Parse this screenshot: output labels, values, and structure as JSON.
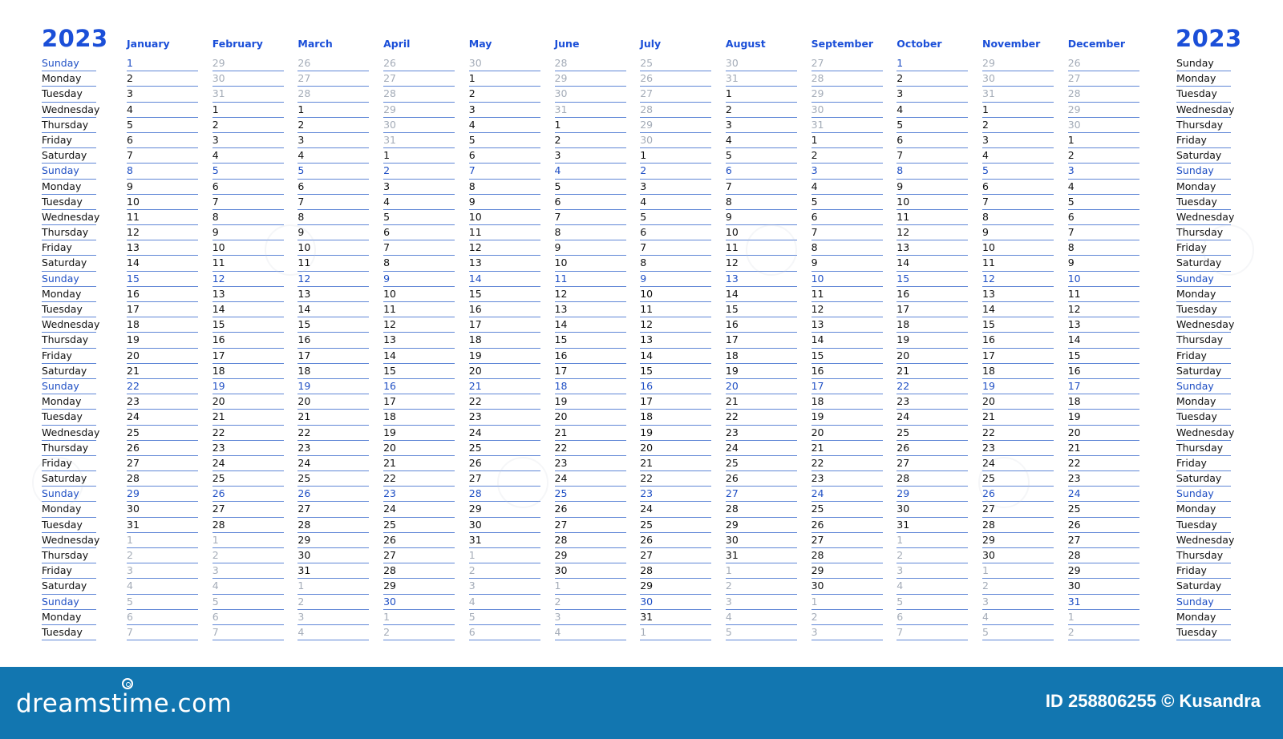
{
  "year_label": "2023",
  "weekday_rows": [
    "Sunday",
    "Monday",
    "Tuesday",
    "Wednesday",
    "Thursday",
    "Friday",
    "Saturday",
    "Sunday",
    "Monday",
    "Tuesday",
    "Wednesday",
    "Thursday",
    "Friday",
    "Saturday",
    "Sunday",
    "Monday",
    "Tuesday",
    "Wednesday",
    "Thursday",
    "Friday",
    "Saturday",
    "Sunday",
    "Monday",
    "Tuesday",
    "Wednesday",
    "Thursday",
    "Friday",
    "Saturday",
    "Sunday",
    "Monday",
    "Tuesday",
    "Wednesday",
    "Thursday",
    "Friday",
    "Saturday",
    "Sunday",
    "Monday",
    "Tuesday"
  ],
  "colors": {
    "accent": "#1b4fd8",
    "sunday": "#1f4fc4",
    "out_of_month": "#a4acb8",
    "rule": "#5f86d6",
    "footer": "#1276b0"
  },
  "months": [
    {
      "name": "January",
      "days": [
        "1",
        "2",
        "3",
        "4",
        "5",
        "6",
        "7",
        "8",
        "9",
        "10",
        "11",
        "12",
        "13",
        "14",
        "15",
        "16",
        "17",
        "18",
        "19",
        "20",
        "21",
        "22",
        "23",
        "24",
        "25",
        "26",
        "27",
        "28",
        "29",
        "30",
        "31",
        "1",
        "2",
        "3",
        "4",
        "5",
        "6",
        "7"
      ],
      "lead": 0,
      "len": 31
    },
    {
      "name": "February",
      "days": [
        "29",
        "30",
        "31",
        "1",
        "2",
        "3",
        "4",
        "5",
        "6",
        "7",
        "8",
        "9",
        "10",
        "11",
        "12",
        "13",
        "14",
        "15",
        "16",
        "17",
        "18",
        "19",
        "20",
        "21",
        "22",
        "23",
        "24",
        "25",
        "26",
        "27",
        "28",
        "1",
        "2",
        "3",
        "4",
        "5",
        "6",
        "7"
      ],
      "lead": 3,
      "len": 28
    },
    {
      "name": "March",
      "days": [
        "26",
        "27",
        "28",
        "1",
        "2",
        "3",
        "4",
        "5",
        "6",
        "7",
        "8",
        "9",
        "10",
        "11",
        "12",
        "13",
        "14",
        "15",
        "16",
        "17",
        "18",
        "19",
        "20",
        "21",
        "22",
        "23",
        "24",
        "25",
        "26",
        "27",
        "28",
        "29",
        "30",
        "31",
        "1",
        "2",
        "3",
        "4"
      ],
      "lead": 3,
      "len": 31
    },
    {
      "name": "April",
      "days": [
        "26",
        "27",
        "28",
        "29",
        "30",
        "31",
        "1",
        "2",
        "3",
        "4",
        "5",
        "6",
        "7",
        "8",
        "9",
        "10",
        "11",
        "12",
        "13",
        "14",
        "15",
        "16",
        "17",
        "18",
        "19",
        "20",
        "21",
        "22",
        "23",
        "24",
        "25",
        "26",
        "27",
        "28",
        "29",
        "30",
        "1",
        "2"
      ],
      "lead": 6,
      "len": 30
    },
    {
      "name": "May",
      "days": [
        "30",
        "1",
        "2",
        "3",
        "4",
        "5",
        "6",
        "7",
        "8",
        "9",
        "10",
        "11",
        "12",
        "13",
        "14",
        "15",
        "16",
        "17",
        "18",
        "19",
        "20",
        "21",
        "22",
        "23",
        "24",
        "25",
        "26",
        "27",
        "28",
        "29",
        "30",
        "31",
        "1",
        "2",
        "3",
        "4",
        "5",
        "6"
      ],
      "lead": 1,
      "len": 31
    },
    {
      "name": "June",
      "days": [
        "28",
        "29",
        "30",
        "31",
        "1",
        "2",
        "3",
        "4",
        "5",
        "6",
        "7",
        "8",
        "9",
        "10",
        "11",
        "12",
        "13",
        "14",
        "15",
        "16",
        "17",
        "18",
        "19",
        "20",
        "21",
        "22",
        "23",
        "24",
        "25",
        "26",
        "27",
        "28",
        "29",
        "30",
        "1",
        "2",
        "3",
        "4"
      ],
      "lead": 4,
      "len": 30
    },
    {
      "name": "July",
      "days": [
        "25",
        "26",
        "27",
        "28",
        "29",
        "30",
        "1",
        "2",
        "3",
        "4",
        "5",
        "6",
        "7",
        "8",
        "9",
        "10",
        "11",
        "12",
        "13",
        "14",
        "15",
        "16",
        "17",
        "18",
        "19",
        "20",
        "21",
        "22",
        "23",
        "24",
        "25",
        "26",
        "27",
        "28",
        "29",
        "30",
        "31",
        "1"
      ],
      "lead": 6,
      "len": 31
    },
    {
      "name": "August",
      "days": [
        "30",
        "31",
        "1",
        "2",
        "3",
        "4",
        "5",
        "6",
        "7",
        "8",
        "9",
        "10",
        "11",
        "12",
        "13",
        "14",
        "15",
        "16",
        "17",
        "18",
        "19",
        "20",
        "21",
        "22",
        "23",
        "24",
        "25",
        "26",
        "27",
        "28",
        "29",
        "30",
        "31",
        "1",
        "2",
        "3",
        "4",
        "5"
      ],
      "lead": 2,
      "len": 31
    },
    {
      "name": "September",
      "days": [
        "27",
        "28",
        "29",
        "30",
        "31",
        "1",
        "2",
        "3",
        "4",
        "5",
        "6",
        "7",
        "8",
        "9",
        "10",
        "11",
        "12",
        "13",
        "14",
        "15",
        "16",
        "17",
        "18",
        "19",
        "20",
        "21",
        "22",
        "23",
        "24",
        "25",
        "26",
        "27",
        "28",
        "29",
        "30",
        "1",
        "2",
        "3"
      ],
      "lead": 5,
      "len": 30
    },
    {
      "name": "October",
      "days": [
        "1",
        "2",
        "3",
        "4",
        "5",
        "6",
        "7",
        "8",
        "9",
        "10",
        "11",
        "12",
        "13",
        "14",
        "15",
        "16",
        "17",
        "18",
        "19",
        "20",
        "21",
        "22",
        "23",
        "24",
        "25",
        "26",
        "27",
        "28",
        "29",
        "30",
        "31",
        "1",
        "2",
        "3",
        "4",
        "5",
        "6",
        "7"
      ],
      "lead": 0,
      "len": 31
    },
    {
      "name": "November",
      "days": [
        "29",
        "30",
        "31",
        "1",
        "2",
        "3",
        "4",
        "5",
        "6",
        "7",
        "8",
        "9",
        "10",
        "11",
        "12",
        "13",
        "14",
        "15",
        "16",
        "17",
        "18",
        "19",
        "20",
        "21",
        "22",
        "23",
        "24",
        "25",
        "26",
        "27",
        "28",
        "29",
        "30",
        "1",
        "2",
        "3",
        "4",
        "5"
      ],
      "lead": 3,
      "len": 30
    },
    {
      "name": "December",
      "days": [
        "26",
        "27",
        "28",
        "29",
        "30",
        "1",
        "2",
        "3",
        "4",
        "5",
        "6",
        "7",
        "8",
        "9",
        "10",
        "11",
        "12",
        "13",
        "14",
        "15",
        "16",
        "17",
        "18",
        "19",
        "20",
        "21",
        "22",
        "23",
        "24",
        "25",
        "26",
        "27",
        "28",
        "29",
        "30",
        "31",
        "1",
        "2"
      ],
      "lead": 5,
      "len": 31
    }
  ],
  "footer": {
    "brand": "dreamstime.com",
    "credit": "ID 258806255 © Kusandra"
  }
}
